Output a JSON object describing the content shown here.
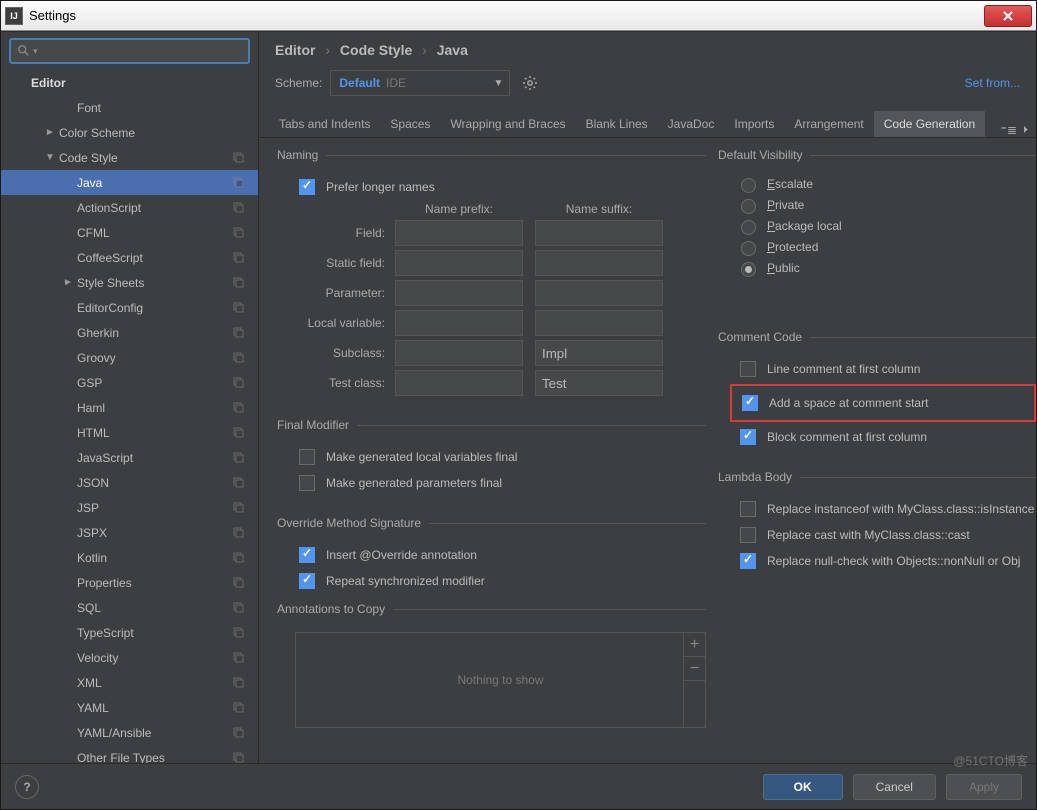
{
  "window": {
    "title": "Settings"
  },
  "search": {
    "placeholder": ""
  },
  "sidebar": {
    "root": "Editor",
    "items": [
      {
        "label": "Font",
        "lv": 2
      },
      {
        "label": "Color Scheme",
        "lv": 1,
        "arrow": "►"
      },
      {
        "label": "Code Style",
        "lv": 1,
        "arrow": "▼",
        "copy": true
      },
      {
        "label": "Java",
        "lv": 2,
        "sel": true,
        "copy": true
      },
      {
        "label": "ActionScript",
        "lv": 2,
        "copy": true
      },
      {
        "label": "CFML",
        "lv": 2,
        "copy": true
      },
      {
        "label": "CoffeeScript",
        "lv": 2,
        "copy": true
      },
      {
        "label": "Style Sheets",
        "lv": 2,
        "arrow": "►",
        "copy": true
      },
      {
        "label": "EditorConfig",
        "lv": 2,
        "copy": true
      },
      {
        "label": "Gherkin",
        "lv": 2,
        "copy": true
      },
      {
        "label": "Groovy",
        "lv": 2,
        "copy": true
      },
      {
        "label": "GSP",
        "lv": 2,
        "copy": true
      },
      {
        "label": "Haml",
        "lv": 2,
        "copy": true
      },
      {
        "label": "HTML",
        "lv": 2,
        "copy": true
      },
      {
        "label": "JavaScript",
        "lv": 2,
        "copy": true
      },
      {
        "label": "JSON",
        "lv": 2,
        "copy": true
      },
      {
        "label": "JSP",
        "lv": 2,
        "copy": true
      },
      {
        "label": "JSPX",
        "lv": 2,
        "copy": true
      },
      {
        "label": "Kotlin",
        "lv": 2,
        "copy": true
      },
      {
        "label": "Properties",
        "lv": 2,
        "copy": true
      },
      {
        "label": "SQL",
        "lv": 2,
        "copy": true
      },
      {
        "label": "TypeScript",
        "lv": 2,
        "copy": true
      },
      {
        "label": "Velocity",
        "lv": 2,
        "copy": true
      },
      {
        "label": "XML",
        "lv": 2,
        "copy": true
      },
      {
        "label": "YAML",
        "lv": 2,
        "copy": true
      },
      {
        "label": "YAML/Ansible",
        "lv": 2,
        "copy": true
      },
      {
        "label": "Other File Types",
        "lv": 2,
        "copy": true
      }
    ]
  },
  "breadcrumb": [
    "Editor",
    "Code Style",
    "Java"
  ],
  "scheme": {
    "label": "Scheme:",
    "name": "Default",
    "suffix": "IDE"
  },
  "setFrom": "Set from...",
  "tabs": [
    "Tabs and Indents",
    "Spaces",
    "Wrapping and Braces",
    "Blank Lines",
    "JavaDoc",
    "Imports",
    "Arrangement",
    "Code Generation"
  ],
  "activeTab": 7,
  "naming": {
    "legend": "Naming",
    "prefer": "Prefer longer names",
    "hdrPrefix": "Name prefix:",
    "hdrSuffix": "Name suffix:",
    "rows": [
      {
        "label": "Field:",
        "prefix": "",
        "suffix": ""
      },
      {
        "label": "Static field:",
        "prefix": "",
        "suffix": ""
      },
      {
        "label": "Parameter:",
        "prefix": "",
        "suffix": ""
      },
      {
        "label": "Local variable:",
        "prefix": "",
        "suffix": ""
      },
      {
        "label": "Subclass:",
        "prefix": "",
        "suffix": "Impl"
      },
      {
        "label": "Test class:",
        "prefix": "",
        "suffix": "Test"
      }
    ]
  },
  "finalMod": {
    "legend": "Final Modifier",
    "opts": [
      "Make generated local variables final",
      "Make generated parameters final"
    ]
  },
  "override": {
    "legend": "Override Method Signature",
    "opt1": "Insert @Override annotation",
    "opt2": "Repeat synchronized modifier",
    "annoLegend": "Annotations to Copy",
    "empty": "Nothing to show"
  },
  "visibility": {
    "legend": "Default Visibility",
    "opts": [
      "Escalate",
      "Private",
      "Package local",
      "Protected",
      "Public"
    ],
    "selected": 4
  },
  "comment": {
    "legend": "Comment Code",
    "opt1": "Line comment at first column",
    "opt2": "Add a space at comment start",
    "opt3": "Block comment at first column"
  },
  "lambda": {
    "legend": "Lambda Body",
    "opt1": "Replace instanceof with MyClass.class::isInstance",
    "opt2": "Replace cast with MyClass.class::cast",
    "opt3": "Replace null-check with Objects::nonNull or Obj"
  },
  "footer": {
    "ok": "OK",
    "cancel": "Cancel",
    "apply": "Apply",
    "help": "?"
  },
  "watermark": "@51CTO博客"
}
